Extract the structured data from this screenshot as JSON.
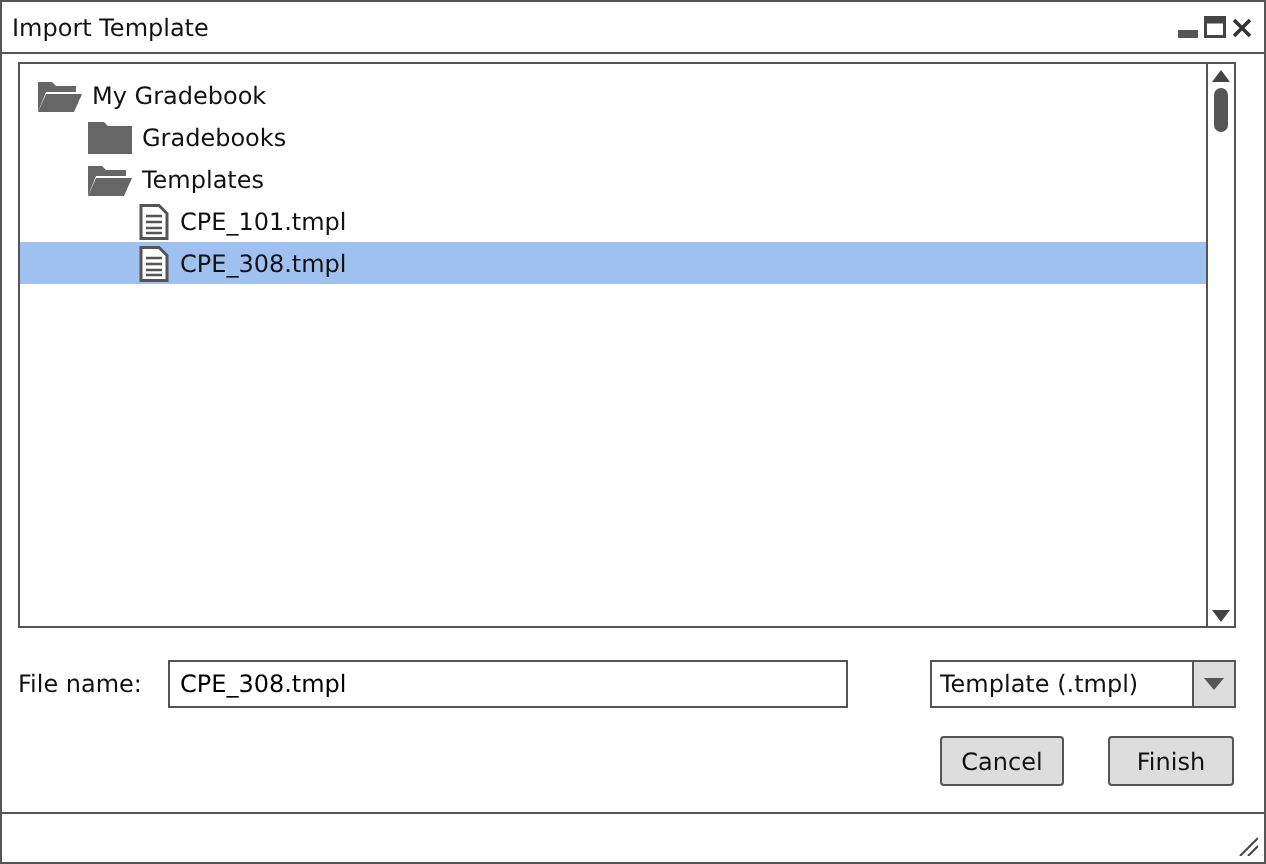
{
  "window": {
    "title": "Import Template"
  },
  "tree": [
    {
      "label": "My Gradebook",
      "kind": "folder",
      "expanded": true,
      "selected": false,
      "children": [
        {
          "label": "Gradebooks",
          "kind": "folder",
          "expanded": false,
          "selected": false
        },
        {
          "label": "Templates",
          "kind": "folder",
          "expanded": true,
          "selected": false,
          "children": [
            {
              "label": "CPE_101.tmpl",
              "kind": "file",
              "selected": false
            },
            {
              "label": "CPE_308.tmpl",
              "kind": "file",
              "selected": true
            }
          ]
        }
      ]
    }
  ],
  "file_name": {
    "label": "File name:",
    "value": "CPE_308.tmpl"
  },
  "file_type": {
    "value": "Template (.tmpl)"
  },
  "buttons": [
    "Cancel",
    "Finish"
  ]
}
